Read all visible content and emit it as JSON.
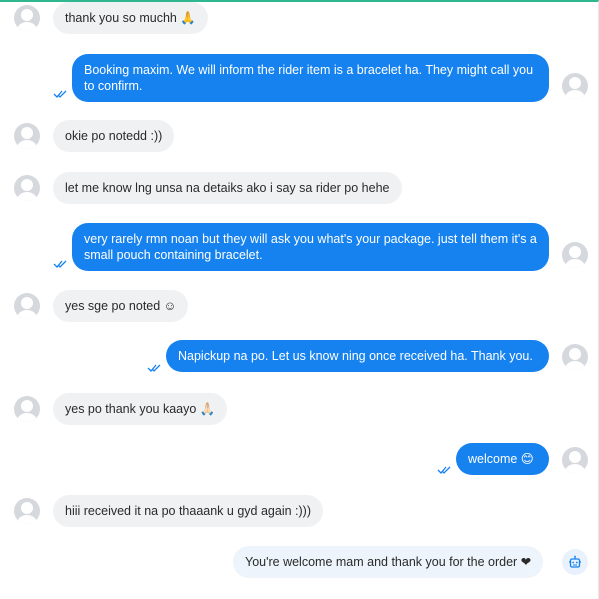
{
  "messages": [
    {
      "dir": "in",
      "text": "thank you so muchh 🙏"
    },
    {
      "dir": "out",
      "text": "Booking maxim. We will inform the rider item is a bracelet ha. They might call you to confirm."
    },
    {
      "dir": "in",
      "text": "okie po notedd :))"
    },
    {
      "dir": "in",
      "text": "let me know lng unsa na detaiks ako i say sa rider po hehe"
    },
    {
      "dir": "out",
      "text": "very rarely rmn noan but they will ask you what's your package. just tell them it's a small pouch containing bracelet."
    },
    {
      "dir": "in",
      "text": "yes sge po noted ☺"
    },
    {
      "dir": "out",
      "text": "Napickup na po. Let us know ning once received ha. Thank you."
    },
    {
      "dir": "in",
      "text": "yes po thank you kaayo 🙏🏻"
    },
    {
      "dir": "out",
      "text": "welcome 😊"
    },
    {
      "dir": "in",
      "text": "hiii received it na po thaaank u gyd again :)))"
    },
    {
      "dir": "bot",
      "text": "You're welcome mam and thank you for the order ❤"
    }
  ],
  "colors": {
    "outgoing_bubble": "#1682f0",
    "incoming_bubble": "#f0f1f3",
    "bot_bubble": "#eef4fb",
    "read_tick": "#1682f0",
    "accent_line": "#2fb88f"
  },
  "icons": {
    "avatar": "user-avatar-icon",
    "bot": "bot-icon",
    "read_receipt": "double-check-icon"
  }
}
